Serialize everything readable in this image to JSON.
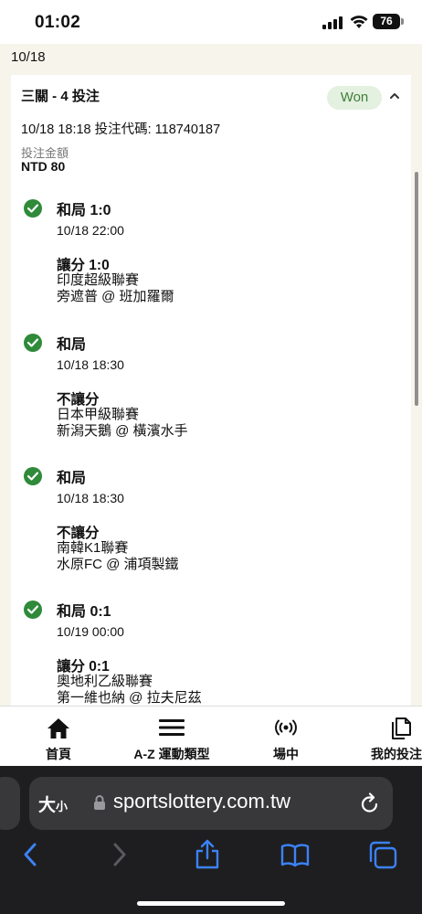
{
  "status_bar": {
    "time": "01:02",
    "battery": "76"
  },
  "page": {
    "date_header": "10/18"
  },
  "bet": {
    "title": "三關 - 4 投注",
    "status": "Won",
    "meta": "10/18 18:18 投注代碼: 118740187",
    "amount_label": "投注金額",
    "amount_value": "NTD 80",
    "legs": [
      {
        "result": "和局 1:0",
        "time": "10/18 22:00",
        "market": "讓分 1:0",
        "league": "印度超級聯賽",
        "teams": "旁遮普 @ 班加羅爾"
      },
      {
        "result": "和局",
        "time": "10/18 18:30",
        "market": "不讓分",
        "league": "日本甲級聯賽",
        "teams": "新潟天鵝 @ 橫濱水手"
      },
      {
        "result": "和局",
        "time": "10/18 18:30",
        "market": "不讓分",
        "league": "南韓K1聯賽",
        "teams": "水原FC @ 浦項製鐵"
      },
      {
        "result": "和局 0:1",
        "time": "10/19 00:00",
        "market": "讓分 0:1",
        "league": "奧地利乙級聯賽",
        "teams": "第一維也納 @ 拉夫尼茲"
      }
    ]
  },
  "tabbar": {
    "tabs": [
      {
        "label": "首頁",
        "icon": "home-icon"
      },
      {
        "label": "A-Z 運動類型",
        "icon": "menu-icon"
      },
      {
        "label": "場中",
        "icon": "live-icon"
      },
      {
        "label": "我的投注",
        "icon": "copy-icon"
      }
    ]
  },
  "browser": {
    "text_size_label": "大",
    "text_size_small": "小",
    "url": "sportslottery.com.tw"
  },
  "colors": {
    "won_badge_bg": "#e4f0e0",
    "won_badge_text": "#3f7f3a",
    "check": "#2f8a3a",
    "page_bg": "#f7f4ec"
  }
}
